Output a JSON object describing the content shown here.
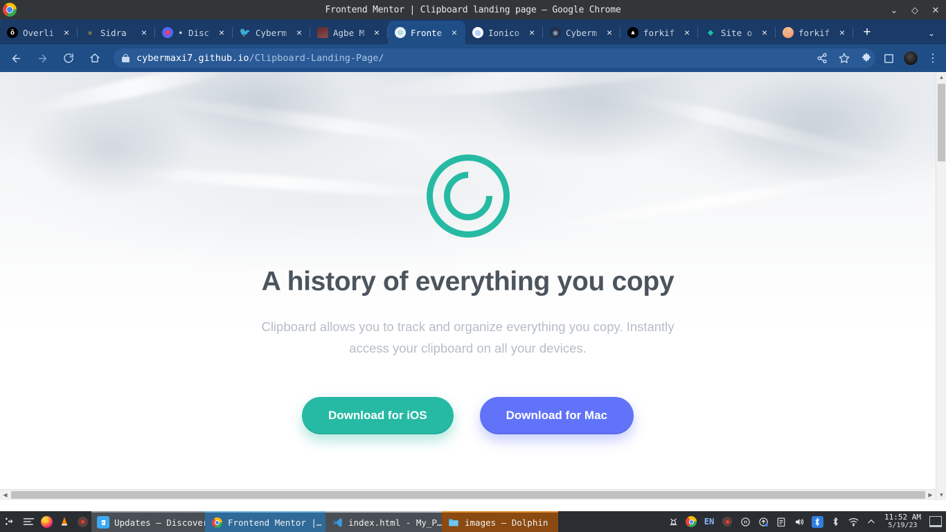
{
  "browser": {
    "window_title": "Frontend Mentor | Clipboard landing page – Google Chrome",
    "window_controls": {
      "minimize": "⌄",
      "maximize": "◇",
      "close": "✕"
    },
    "tabs": [
      {
        "title": "Overli",
        "icon": "overleaf-icon",
        "glyph": "ō",
        "class": "fi-overleaf",
        "active": false
      },
      {
        "title": "Sidra",
        "icon": "sidra-icon",
        "glyph": "✳",
        "class": "fi-sidra",
        "active": false
      },
      {
        "title": "• Disc",
        "icon": "discord-icon",
        "glyph": "",
        "class": "fi-discord",
        "active": false
      },
      {
        "title": "Cyberm",
        "icon": "twitter-icon",
        "glyph": "🐦",
        "class": "fi-twitter",
        "active": false
      },
      {
        "title": "Agbe M",
        "icon": "avatar-icon",
        "glyph": "",
        "class": "fi-agbe",
        "active": false
      },
      {
        "title": "Fronte",
        "icon": "clipboard-icon",
        "glyph": "☺",
        "class": "fi-clip",
        "active": true
      },
      {
        "title": "Ionico",
        "icon": "ionic-icon",
        "glyph": "◎",
        "class": "fi-ionic",
        "active": false
      },
      {
        "title": "Cyberm",
        "icon": "github-icon",
        "glyph": "◉",
        "class": "fi-github",
        "active": false
      },
      {
        "title": "forkif",
        "icon": "forkify-icon",
        "glyph": "▲",
        "class": "fi-forkify",
        "active": false
      },
      {
        "title": "Site o",
        "icon": "diamond-icon",
        "glyph": "◆",
        "class": "fi-site",
        "active": false
      },
      {
        "title": "forkif",
        "icon": "forkify-food-icon",
        "glyph": "🍴",
        "class": "fi-forkify2",
        "active": false
      }
    ],
    "tab_close_label": "✕",
    "new_tab_label": "+",
    "tab_list_label": "⌄",
    "toolbar": {
      "back_label": "←",
      "forward_label": "→",
      "reload_label": "⟳",
      "home_label": "⌂",
      "url_host": "cybermaxi7.github.io",
      "url_path": "/Clipboard-Landing-Page/",
      "share_label": "⦛",
      "bookmark_label": "☆",
      "extensions_label": "🧩",
      "sidepanel_label": "▢",
      "menu_label": "⋮"
    }
  },
  "page": {
    "logo_alt": "Clipboard logo",
    "headline": "A history of everything you copy",
    "subhead": "Clipboard allows you to track and organize everything you copy. Instantly access your clipboard on all your devices.",
    "buttons": [
      {
        "label": "Download for iOS",
        "color": "#26baa4"
      },
      {
        "label": "Download for Mac",
        "color": "#6173f8"
      }
    ]
  },
  "scrollbars": {
    "up_arrow": "▲",
    "down_arrow": "▼",
    "left_arrow": "◀",
    "right_arrow": "▶"
  },
  "taskbar": {
    "launcher_label": "⣿",
    "quick_launch": [
      {
        "name": "app-menu-icon",
        "glyph": "≡"
      },
      {
        "name": "firefox-icon",
        "glyph": ""
      },
      {
        "name": "vlc-icon",
        "glyph": ""
      },
      {
        "name": "record-icon",
        "glyph": ""
      }
    ],
    "windows": [
      {
        "label": "Updates — Discover",
        "icon": "discover-icon",
        "class": "t-updates"
      },
      {
        "label": "Frontend Mentor |…",
        "icon": "chrome-icon",
        "class": "t-chrome"
      },
      {
        "label": "index.html - My_P…",
        "icon": "vscode-icon",
        "class": "t-code"
      },
      {
        "label": "images — Dolphin",
        "icon": "folder-icon",
        "class": "t-dolphin"
      }
    ],
    "tray": [
      {
        "name": "notifications-icon",
        "glyph": "🔔"
      },
      {
        "name": "chrome-tray-icon",
        "glyph": ""
      },
      {
        "name": "keyboard-language-indicator",
        "glyph": "EN"
      },
      {
        "name": "recorder-icon",
        "glyph": ""
      },
      {
        "name": "media-pause-icon",
        "glyph": "⏸"
      },
      {
        "name": "updates-icon",
        "glyph": "⬆"
      },
      {
        "name": "clipboard-tray-icon",
        "glyph": "📋"
      },
      {
        "name": "volume-icon",
        "glyph": "🔊"
      },
      {
        "name": "bluetooth-active-icon",
        "glyph": "✚"
      },
      {
        "name": "bluetooth-icon",
        "glyph": "✚"
      },
      {
        "name": "wifi-icon",
        "glyph": "📶"
      },
      {
        "name": "show-hidden-icon",
        "glyph": "⌃"
      }
    ],
    "clock_time": "11:52 AM",
    "clock_date": "5/19/23",
    "show_desktop_label": ""
  }
}
